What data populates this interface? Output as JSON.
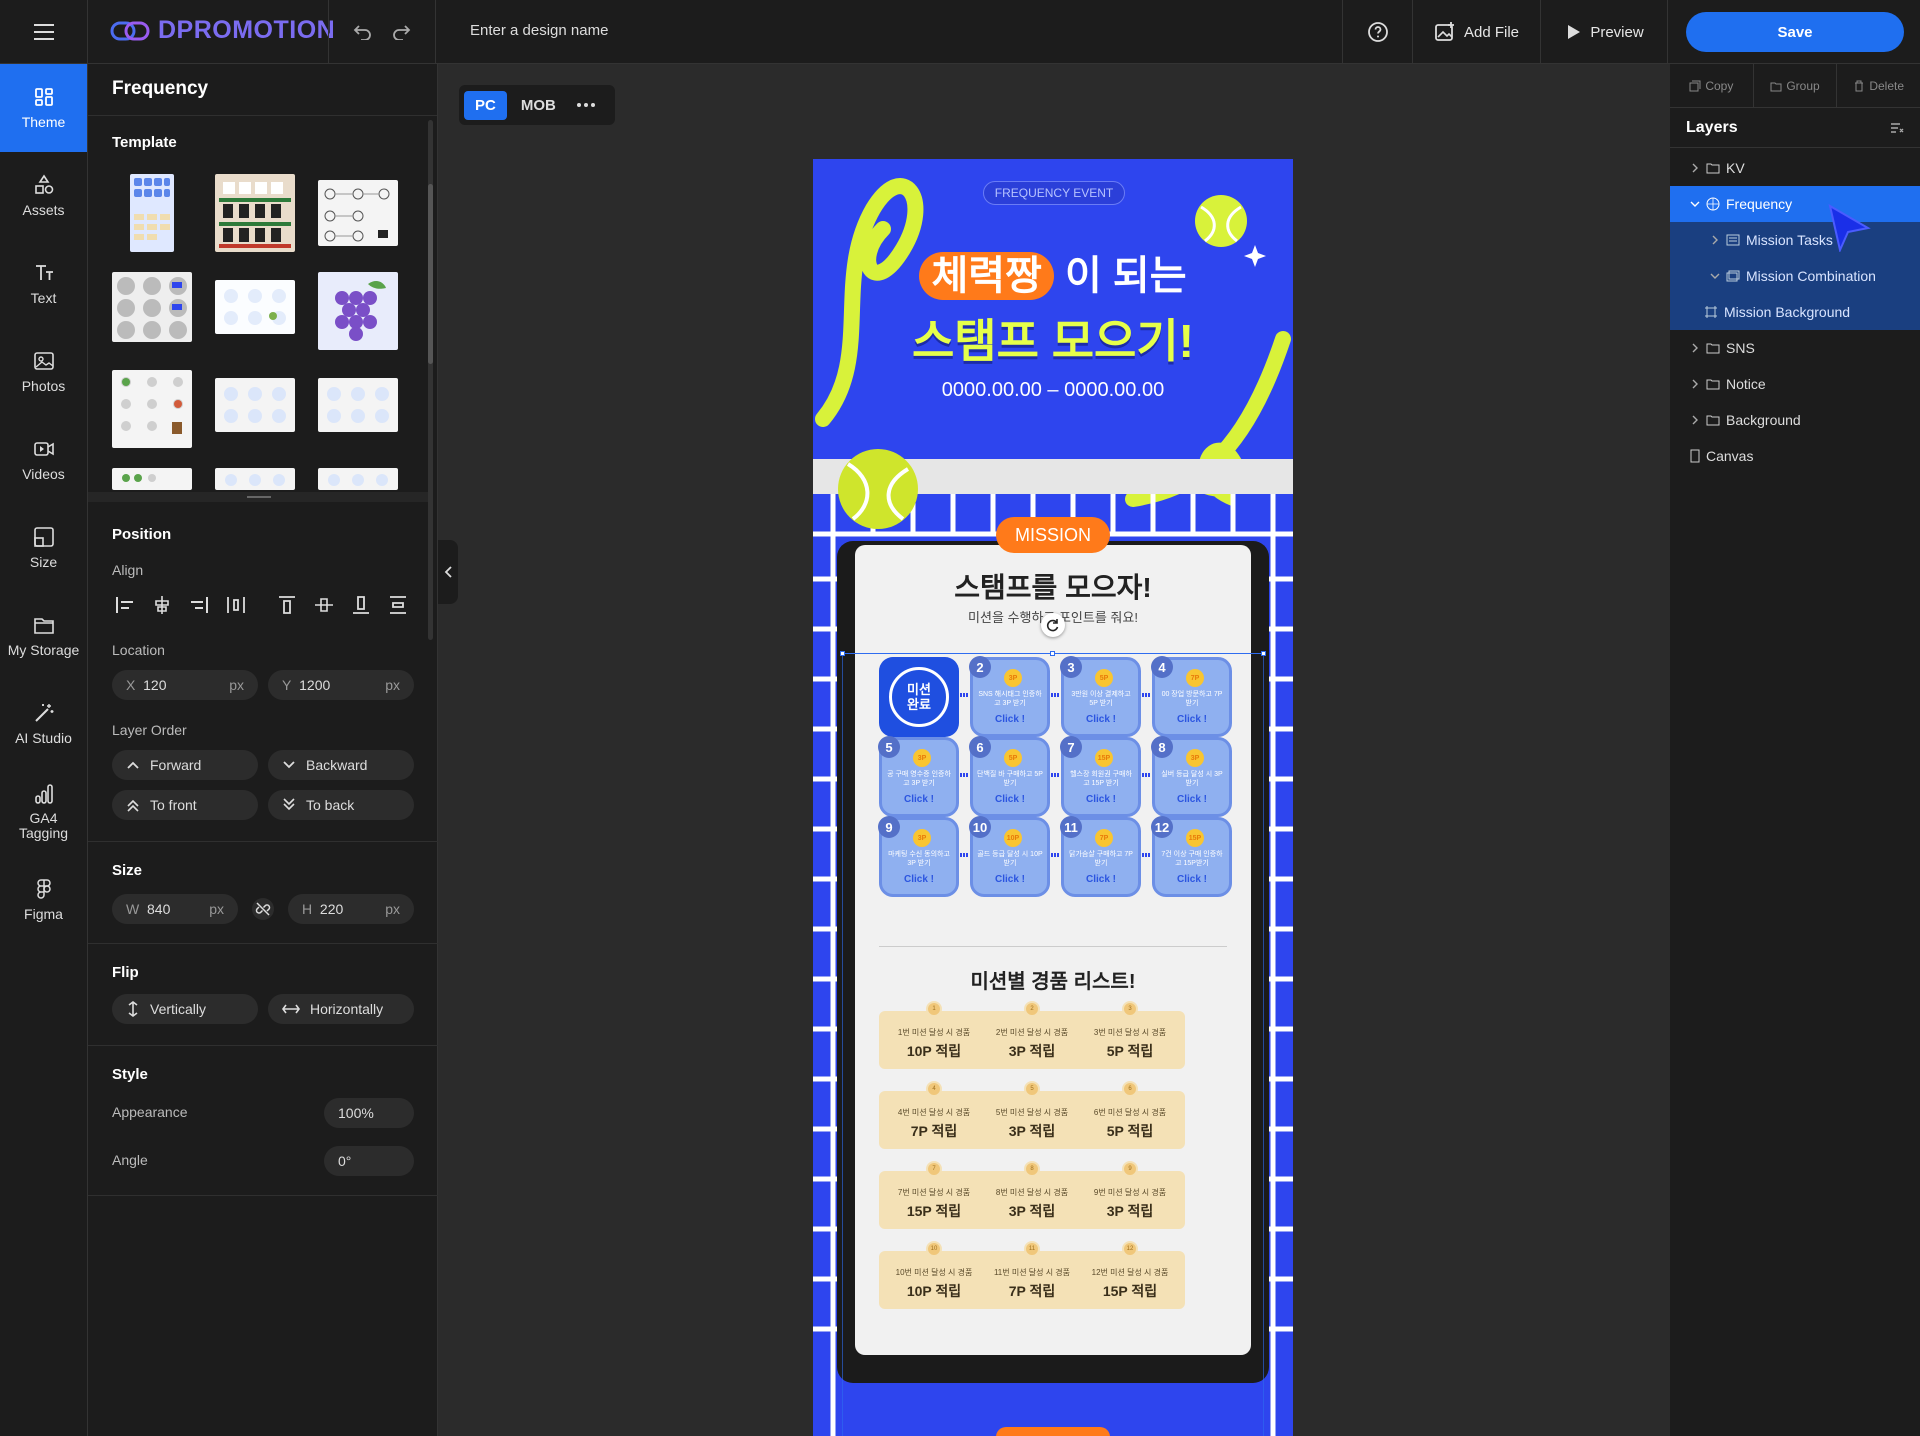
{
  "topbar": {
    "brand": "DPROMOTION",
    "design_name_placeholder": "Enter a design name",
    "add_file": "Add File",
    "preview": "Preview",
    "save": "Save"
  },
  "sidebar": {
    "items": [
      {
        "label": "Theme",
        "icon": "theme-icon"
      },
      {
        "label": "Assets",
        "icon": "shapes-icon"
      },
      {
        "label": "Text",
        "icon": "text-icon"
      },
      {
        "label": "Photos",
        "icon": "photo-icon"
      },
      {
        "label": "Videos",
        "icon": "video-icon"
      },
      {
        "label": "Size",
        "icon": "size-icon"
      },
      {
        "label": "My Storage",
        "icon": "folder-icon"
      },
      {
        "label": "AI Studio",
        "icon": "magic-wand-icon"
      },
      {
        "label": "GA4 Tagging",
        "icon": "analytics-icon"
      },
      {
        "label": "Figma",
        "icon": "figma-icon"
      }
    ]
  },
  "panel": {
    "title": "Frequency",
    "template_label": "Template",
    "position_label": "Position",
    "align_label": "Align",
    "location_label": "Location",
    "x_label": "X",
    "x_value": "120",
    "y_label": "Y",
    "y_value": "1200",
    "unit": "px",
    "layer_order_label": "Layer Order",
    "forward": "Forward",
    "backward": "Backward",
    "to_front": "To front",
    "to_back": "To back",
    "size_label": "Size",
    "w_label": "W",
    "w_value": "840",
    "h_label": "H",
    "h_value": "220",
    "flip_label": "Flip",
    "vertically": "Vertically",
    "horizontally": "Horizontally",
    "style_label": "Style",
    "appearance_label": "Appearance",
    "appearance_value": "100%",
    "angle_label": "Angle",
    "angle_value": "0°"
  },
  "viewport": {
    "pc": "PC",
    "mob": "MOB"
  },
  "design": {
    "event_tag": "FREQUENCY EVENT",
    "headline_highlight": "체력짱",
    "headline_rest": "이 되는",
    "headline_line2": "스탬프 모으기!",
    "date_range": "0000.00.00 – 0000.00.00",
    "mission_badge": "MISSION",
    "card_title": "스탬프를 모으자!",
    "card_subtitle": "미션을 수행하고 포인트를 줘요!",
    "first_stamp": "미션\n완료",
    "missions": [
      {
        "num": "2",
        "coin": "3P",
        "text": "SNS 해시태그 인증하고 3P 받기",
        "cta": "Click !"
      },
      {
        "num": "3",
        "coin": "5P",
        "text": "3만원 이상 결제하고 5P 받기",
        "cta": "Click !"
      },
      {
        "num": "4",
        "coin": "7P",
        "text": "00 장업 방문하고 7P 받기",
        "cta": "Click !"
      },
      {
        "num": "5",
        "coin": "3P",
        "text": "공 구매 영수증 인증하고 3P 받기",
        "cta": "Click !"
      },
      {
        "num": "6",
        "coin": "5P",
        "text": "단백질 바 구매하고 5P 받기",
        "cta": "Click !"
      },
      {
        "num": "7",
        "coin": "15P",
        "text": "헬스장 회원권 구매하고 15P 받기",
        "cta": "Click !"
      },
      {
        "num": "8",
        "coin": "3P",
        "text": "실버 등급 달성 시 3P 받기",
        "cta": "Click !"
      },
      {
        "num": "9",
        "coin": "3P",
        "text": "마케팅 수신 동의하고 3P 받기",
        "cta": "Click !"
      },
      {
        "num": "10",
        "coin": "10P",
        "text": "골드 등급 달성 시 10P 받기",
        "cta": "Click !"
      },
      {
        "num": "11",
        "coin": "7P",
        "text": "닭가슴살 구매하고 7P 받기",
        "cta": "Click !"
      },
      {
        "num": "12",
        "coin": "15P",
        "text": "7건 이상 구매 인증하고 15P받기",
        "cta": "Click !"
      }
    ],
    "prize_title": "미션별 경품 리스트!",
    "prizes": [
      {
        "num": "1",
        "caption": "1번 미션 달성 시 경품",
        "value": "10P 적립"
      },
      {
        "num": "2",
        "caption": "2번 미션 달성 시 경품",
        "value": "3P 적립"
      },
      {
        "num": "3",
        "caption": "3번 미션 달성 시 경품",
        "value": "5P 적립"
      },
      {
        "num": "4",
        "caption": "4번 미션 달성 시 경품",
        "value": "7P 적립"
      },
      {
        "num": "5",
        "caption": "5번 미션 달성 시 경품",
        "value": "3P 적립"
      },
      {
        "num": "6",
        "caption": "6번 미션 달성 시 경품",
        "value": "5P 적립"
      },
      {
        "num": "7",
        "caption": "7번 미션 달성 시 경품",
        "value": "15P 적립"
      },
      {
        "num": "8",
        "caption": "8번 미션 달성 시 경품",
        "value": "3P 적립"
      },
      {
        "num": "9",
        "caption": "9번 미션 달성 시 경품",
        "value": "3P 적립"
      },
      {
        "num": "10",
        "caption": "10번 미션 달성 시 경품",
        "value": "10P 적립"
      },
      {
        "num": "11",
        "caption": "11번 미션 달성 시 경품",
        "value": "7P 적립"
      },
      {
        "num": "12",
        "caption": "12번 미션 달성 시 경품",
        "value": "15P 적립"
      }
    ]
  },
  "layers": {
    "tools": {
      "copy": "Copy",
      "group": "Group",
      "delete": "Delete"
    },
    "title": "Layers",
    "items": [
      {
        "label": "KV"
      },
      {
        "label": "Frequency"
      },
      {
        "label": "Mission Tasks"
      },
      {
        "label": "Mission Combination"
      },
      {
        "label": "Mission Background"
      },
      {
        "label": "SNS"
      },
      {
        "label": "Notice"
      },
      {
        "label": "Background"
      },
      {
        "label": "Canvas"
      }
    ]
  },
  "colors": {
    "accent": "#1f6ff0",
    "design_blue": "#2e45ee",
    "tennis_yellow": "#d8f23a",
    "mission_orange": "#ff7a1a"
  }
}
